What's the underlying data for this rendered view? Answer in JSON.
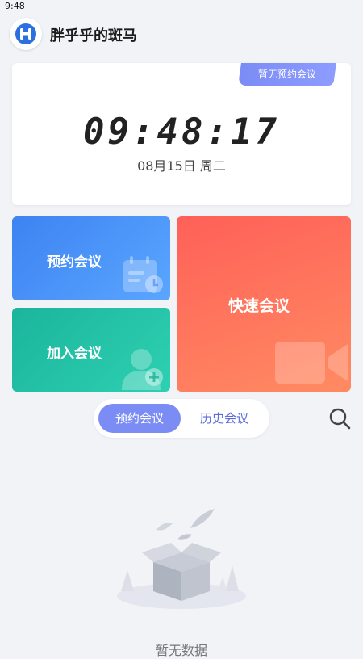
{
  "status_bar": {
    "time": "9:48"
  },
  "app": {
    "title": "胖乎乎的斑马"
  },
  "clock_card": {
    "tag": "暂无预约会议",
    "time": "09:48:17",
    "date": "08月15日 周二"
  },
  "tiles": {
    "schedule": "预约会议",
    "join": "加入会议",
    "quick": "快速会议"
  },
  "tabs": {
    "scheduled": "预约会议",
    "history": "历史会议",
    "active": "scheduled"
  },
  "empty_state": {
    "text": "暂无数据"
  },
  "colors": {
    "accent": "#7b8df4",
    "schedule_tile": "#3d83f2",
    "join_tile": "#1bb59c",
    "quick_tile": "#ff6d5c"
  }
}
